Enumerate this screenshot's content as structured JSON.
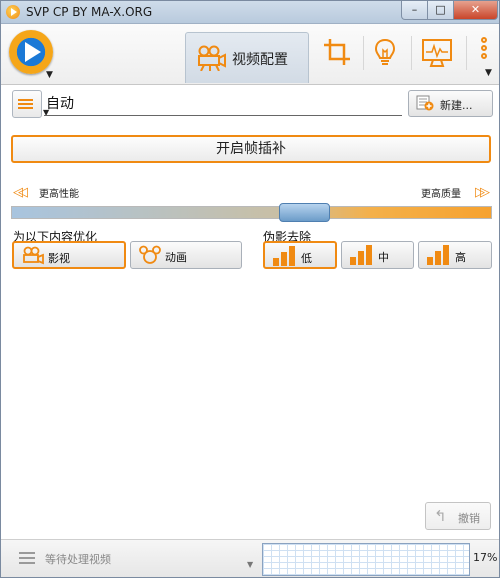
{
  "window": {
    "title": "SVP CP BY MA-X.ORG",
    "min_glyph": "–",
    "max_glyph": "□",
    "close_glyph": "✕"
  },
  "toolbar": {
    "tabs": [
      {
        "label": "视频配置",
        "icon": "video-camera-icon",
        "active": true
      },
      {
        "label": "",
        "icon": "crop-icon"
      },
      {
        "label": "",
        "icon": "lightbulb-icon"
      },
      {
        "label": "",
        "icon": "monitor-icon"
      }
    ]
  },
  "profile": {
    "value": "自动",
    "new_button_label": "新建..."
  },
  "frame_interpolation": {
    "button_label": "开启帧插补"
  },
  "slider": {
    "left_label": "更高性能",
    "right_label": "更高质量",
    "position": 0.6
  },
  "optimize": {
    "label": "为以下内容优化",
    "options": [
      {
        "label": "影视",
        "active": true
      },
      {
        "label": "动画",
        "active": false
      }
    ]
  },
  "artifacts": {
    "label": "伪影去除",
    "options": [
      {
        "label": "低",
        "active": true
      },
      {
        "label": "中",
        "active": false
      },
      {
        "label": "高",
        "active": false
      }
    ]
  },
  "undo": {
    "label": "撤销"
  },
  "status": {
    "queue_text": "等待处理视频",
    "cpu_percent": "17%"
  },
  "colors": {
    "accent": "#f08a12",
    "slider_thumb": "#6c9cc9"
  }
}
